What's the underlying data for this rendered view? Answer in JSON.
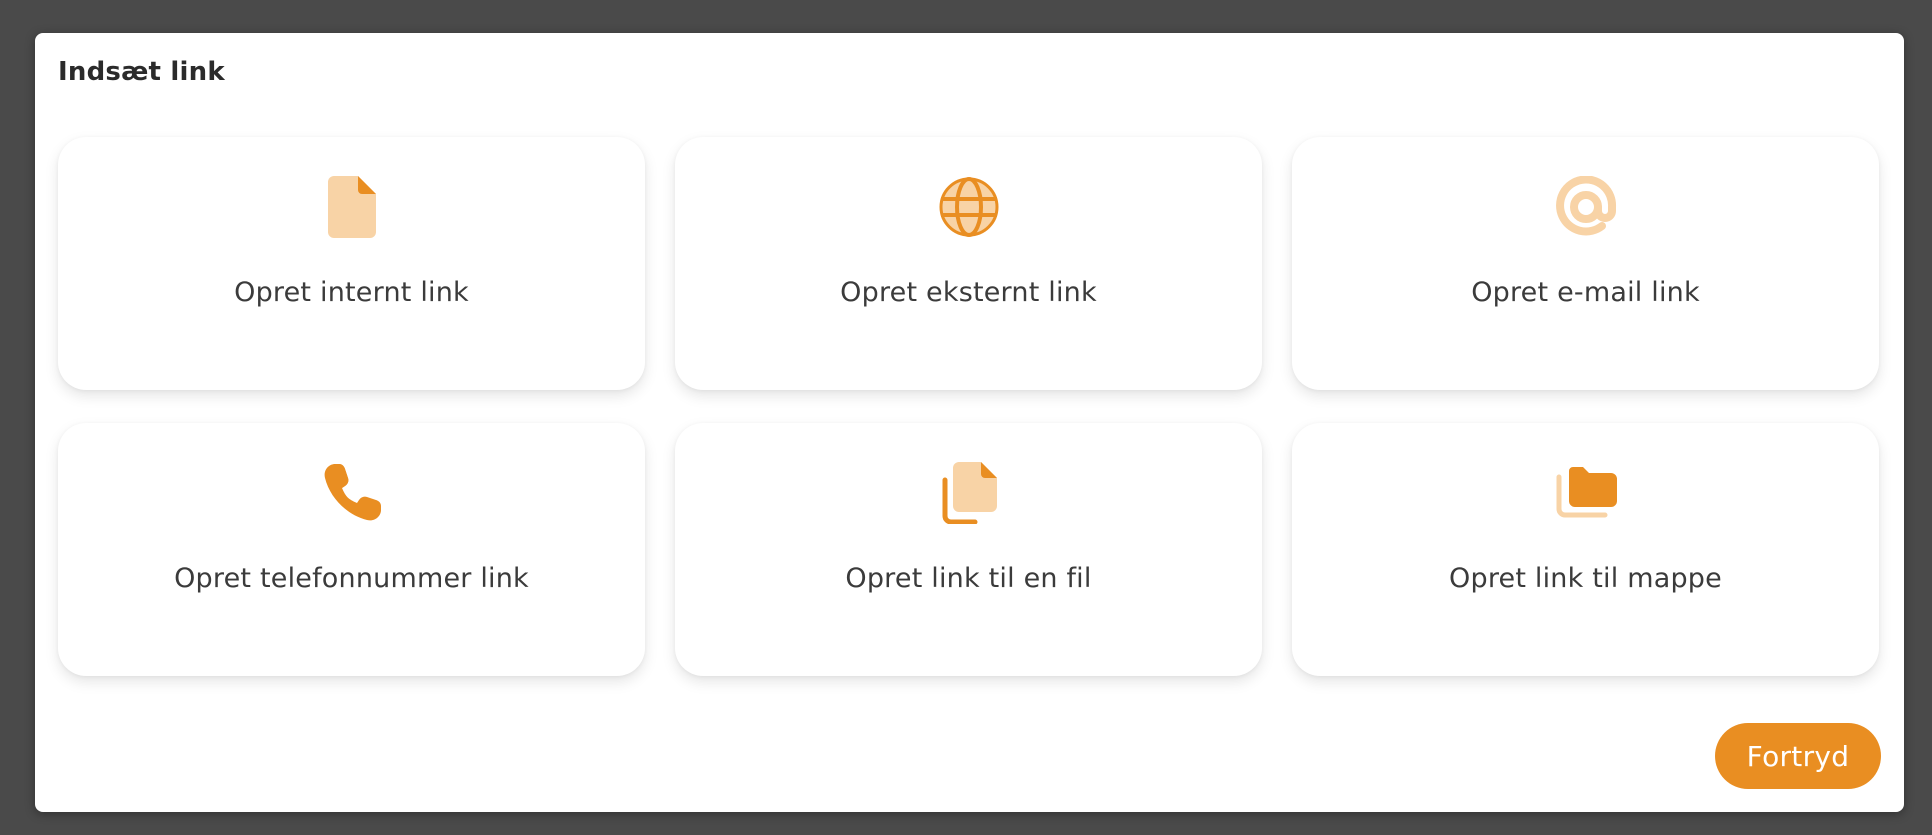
{
  "dialog": {
    "title": "Indsæt link"
  },
  "options": [
    {
      "label": "Opret internt link",
      "icon": "document-icon"
    },
    {
      "label": "Opret eksternt link",
      "icon": "globe-icon"
    },
    {
      "label": "Opret e-mail link",
      "icon": "at-sign-icon"
    },
    {
      "label": "Opret telefonnummer link",
      "icon": "phone-icon"
    },
    {
      "label": "Opret link til en fil",
      "icon": "copy-file-icon"
    },
    {
      "label": "Opret link til mappe",
      "icon": "folders-icon"
    }
  ],
  "footer": {
    "cancel_label": "Fortryd"
  },
  "colors": {
    "accent": "#e98e22",
    "accent_light": "#f8d3a6",
    "backdrop": "#4a4a4a"
  }
}
